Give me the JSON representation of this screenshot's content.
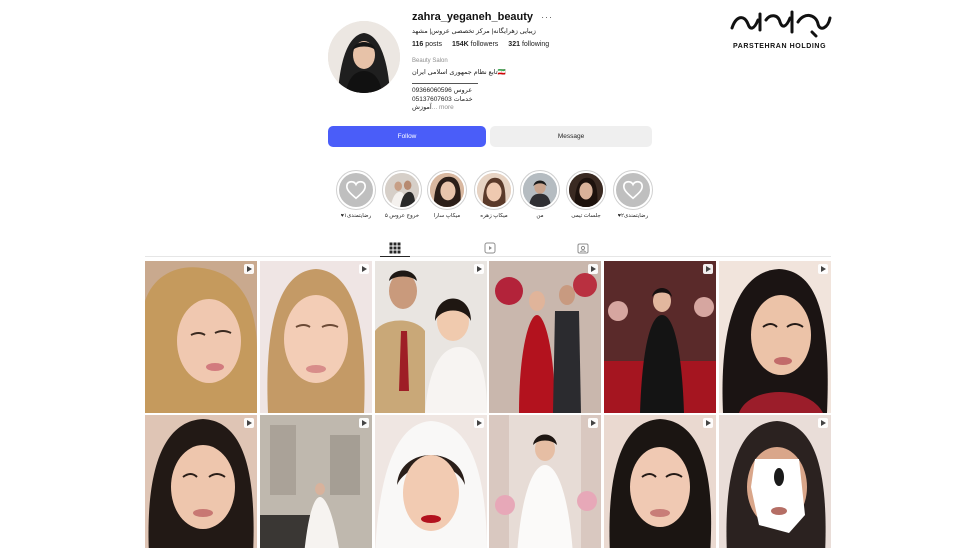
{
  "watermark": {
    "script": "پارس تهران",
    "text": "PARSTEHRAN HOLDING"
  },
  "profile": {
    "username": "zahra_yeganeh_beauty",
    "bio_title": "زیبایی زهرایگانه| مرکز تخصصی عروس| مشهد",
    "stats": {
      "posts": "116",
      "posts_label": "posts",
      "followers": "154K",
      "followers_label": "followers",
      "following": "321",
      "following_label": "following"
    },
    "category": "Beauty Salon",
    "bio_lines": [
      "تابع نظام جمهوری اسلامی ایران🇮🇷",
      "09366060596 عروس",
      "05137607603 خدمات",
      "آموزش"
    ],
    "more_label": "... more"
  },
  "actions": {
    "follow": "Follow",
    "message": "Message"
  },
  "highlights": [
    {
      "label": "♥رضایتمندی۲",
      "icon": "heart-icon"
    },
    {
      "label": "جلسات تیمی",
      "icon": ""
    },
    {
      "label": "من",
      "icon": ""
    },
    {
      "label": "میکاپ زهره",
      "icon": ""
    },
    {
      "label": "میکاپ سارا",
      "icon": ""
    },
    {
      "label": "خروج عروس ۵",
      "icon": ""
    },
    {
      "label": "♥رضایتمندی۱",
      "icon": "heart-icon"
    }
  ],
  "tabs": [
    "posts",
    "reels",
    "tagged"
  ],
  "colors": {
    "follow_button": "#4a5df9",
    "message_button": "#efefef"
  }
}
